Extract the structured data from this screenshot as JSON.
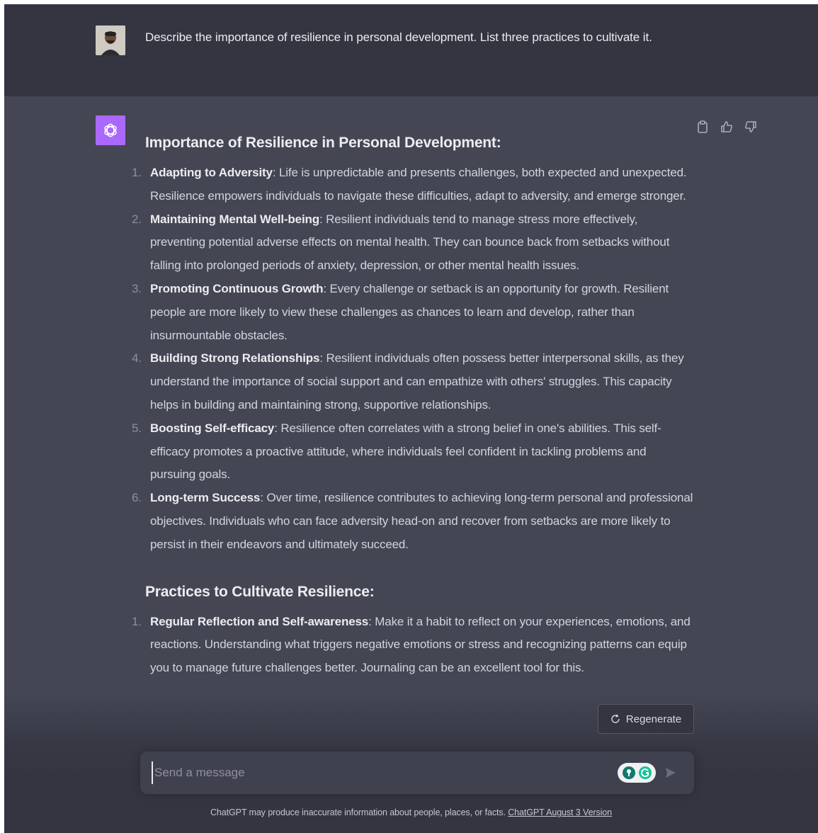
{
  "conversation": {
    "user_message": "Describe the importance of resilience in personal development. List three practices to cultivate it.",
    "assistant": {
      "heading_1": "Importance of Resilience in Personal Development:",
      "list_1": [
        {
          "num": "1.",
          "title": "Adapting to Adversity",
          "text": ": Life is unpredictable and presents challenges, both expected and unexpected. Resilience empowers individuals to navigate these difficulties, adapt to adversity, and emerge stronger."
        },
        {
          "num": "2.",
          "title": "Maintaining Mental Well-being",
          "text": ": Resilient individuals tend to manage stress more effectively, preventing potential adverse effects on mental health. They can bounce back from setbacks without falling into prolonged periods of anxiety, depression, or other mental health issues."
        },
        {
          "num": "3.",
          "title": "Promoting Continuous Growth",
          "text": ": Every challenge or setback is an opportunity for growth. Resilient people are more likely to view these challenges as chances to learn and develop, rather than insurmountable obstacles."
        },
        {
          "num": "4.",
          "title": "Building Strong Relationships",
          "text": ": Resilient individuals often possess better interpersonal skills, as they understand the importance of social support and can empathize with others' struggles. This capacity helps in building and maintaining strong, supportive relationships."
        },
        {
          "num": "5.",
          "title": "Boosting Self-efficacy",
          "text": ": Resilience often correlates with a strong belief in one's abilities. This self-efficacy promotes a proactive attitude, where individuals feel confident in tackling problems and pursuing goals."
        },
        {
          "num": "6.",
          "title": "Long-term Success",
          "text": ": Over time, resilience contributes to achieving long-term personal and professional objectives. Individuals who can face adversity head-on and recover from setbacks are more likely to persist in their endeavors and ultimately succeed."
        }
      ],
      "heading_2": "Practices to Cultivate Resilience:",
      "list_2": [
        {
          "num": "1.",
          "title": "Regular Reflection and Self-awareness",
          "text": ": Make it a habit to reflect on your experiences, emotions, and reactions. Understanding what triggers negative emotions or stress and recognizing patterns can equip you to manage future challenges better. Journaling can be an excellent tool for this."
        }
      ]
    }
  },
  "actions": {
    "copy_icon": "clipboard-icon",
    "like_icon": "thumbs-up-icon",
    "dislike_icon": "thumbs-down-icon"
  },
  "regenerate": {
    "label": "Regenerate"
  },
  "composer": {
    "placeholder": "Send a message"
  },
  "footer": {
    "disclaimer": "ChatGPT may produce inaccurate information about people, places, or facts. ",
    "version_link": "ChatGPT August 3 Version"
  },
  "colors": {
    "user_bg": "#343541",
    "assistant_bg": "#444654",
    "bot_avatar": "#ab68ff",
    "text": "#ececf1"
  }
}
